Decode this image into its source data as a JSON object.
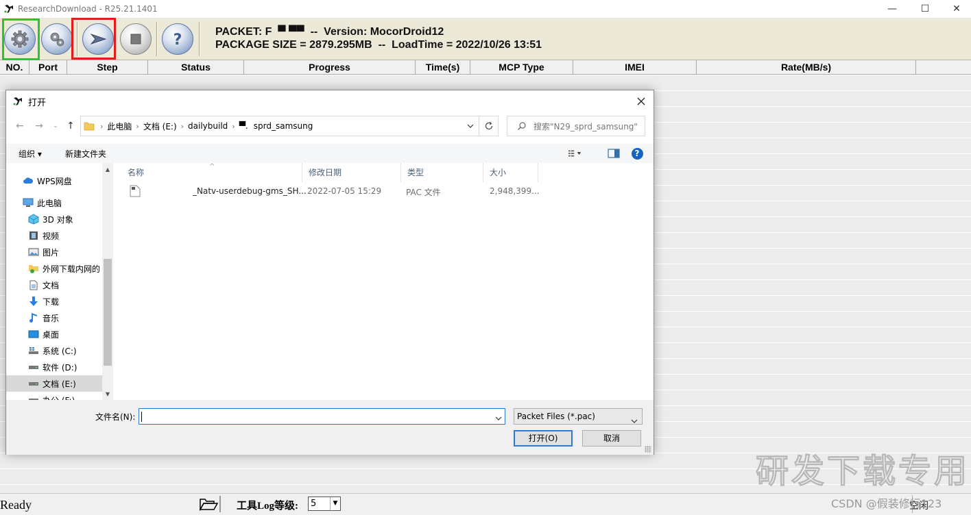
{
  "window": {
    "title": "ResearchDownload - R25.21.1401",
    "minimize_glyph": "—",
    "maximize_glyph": "☐",
    "close_glyph": "✕"
  },
  "packet": {
    "line1": "PACKET: F  ▀ ▀▀  --  Version: MocorDroid12",
    "line2": "PACKAGE SIZE = 2879.295MB  --  LoadTime = 2022/10/26 13:51"
  },
  "toolbar_icons": [
    "settings-gear-icon",
    "settings-gears-icon",
    "play-start-icon",
    "stop-icon",
    "help-question-icon"
  ],
  "columns": [
    {
      "label": "NO."
    },
    {
      "label": "Port"
    },
    {
      "label": "Step"
    },
    {
      "label": "Status"
    },
    {
      "label": "Progress"
    },
    {
      "label": "Time(s)"
    },
    {
      "label": "MCP Type"
    },
    {
      "label": "IMEI"
    },
    {
      "label": "Rate(MB/s)"
    },
    {
      "label": ""
    }
  ],
  "status": {
    "ready": "Ready",
    "log_label": "工具Log等级:",
    "log_level": "5",
    "right_text": "空闲"
  },
  "watermark": {
    "main": "研发下载专用",
    "csdn": "CSDN @假装修行123"
  },
  "dialog": {
    "title": "打开",
    "breadcrumb": [
      "此电脑",
      "文档 (E:)",
      "dailybuild",
      "▀.",
      "sprd_samsung"
    ],
    "search_placeholder": "搜索\"N29_sprd_samsung\"",
    "organize": "组织 ▾",
    "new_folder": "新建文件夹",
    "help_glyph": "?",
    "nav_items": [
      {
        "label": "WPS网盘",
        "icon": "cloud-icon"
      },
      {
        "label": "此电脑",
        "icon": "computer-icon"
      },
      {
        "label": "3D 对象",
        "icon": "cube-icon"
      },
      {
        "label": "视频",
        "icon": "film-icon"
      },
      {
        "label": "图片",
        "icon": "image-icon"
      },
      {
        "label": "外网下载内网的",
        "icon": "network-folder-icon"
      },
      {
        "label": "文档",
        "icon": "document-icon"
      },
      {
        "label": "下载",
        "icon": "download-arrow-icon"
      },
      {
        "label": "音乐",
        "icon": "music-note-icon"
      },
      {
        "label": "桌面",
        "icon": "desktop-icon"
      },
      {
        "label": "系统 (C:)",
        "icon": "windows-drive-icon"
      },
      {
        "label": "软件 (D:)",
        "icon": "drive-icon"
      },
      {
        "label": "文档 (E:)",
        "icon": "drive-icon"
      },
      {
        "label": "办公 (F:)",
        "icon": "drive-icon"
      }
    ],
    "selected_nav_index": 12,
    "file_columns": [
      "名称",
      "修改日期",
      "类型",
      "大小"
    ],
    "files": [
      {
        "name": "_Natv-userdebug-gms_SH...",
        "date": "2022-07-05 15:29",
        "type": "PAC 文件",
        "size": "2,948,399..."
      }
    ],
    "filename_label": "文件名(N):",
    "filename_value": "",
    "filter": "Packet Files (*.pac)",
    "open_button": "打开(O)",
    "cancel_button": "取消"
  },
  "colors": {
    "toolbar_bg": "#ece9d8",
    "highlight_green": "#2fc22f",
    "highlight_red": "#e21b1b",
    "accent_blue": "#2d7bd3"
  }
}
